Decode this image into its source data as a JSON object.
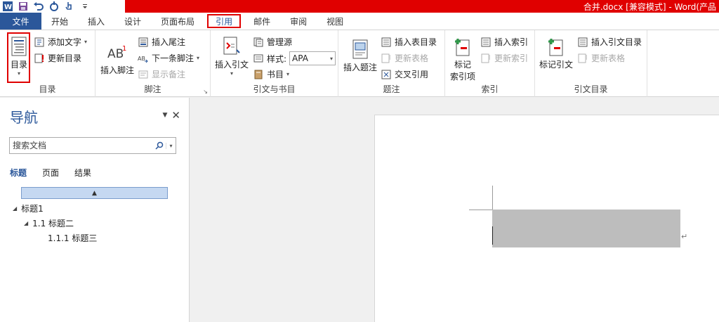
{
  "window": {
    "title": "合并.docx [兼容模式] - Word(产品"
  },
  "quick_access": [
    {
      "icon": "word-logo-icon"
    },
    {
      "icon": "save-icon"
    },
    {
      "icon": "undo-icon"
    },
    {
      "icon": "redo-icon"
    },
    {
      "icon": "touch-mode-icon"
    },
    {
      "icon": "customize-qat-icon"
    }
  ],
  "tabs": {
    "file": "文件",
    "home": "开始",
    "insert": "插入",
    "design": "设计",
    "layout": "页面布局",
    "references": "引用",
    "mailings": "邮件",
    "review": "审阅",
    "view": "视图"
  },
  "ribbon": {
    "toc_group": {
      "label": "目录",
      "toc_button": "目录",
      "add_text": "添加文字",
      "update_table": "更新目录"
    },
    "footnotes_group": {
      "label": "脚注",
      "insert_footnote": "插入脚注",
      "insert_endnote": "插入尾注",
      "next_footnote": "下一条脚注",
      "show_notes": "显示备注"
    },
    "citations_group": {
      "label": "引文与书目",
      "insert_citation": "插入引文",
      "manage_sources": "管理源",
      "style_label": "样式:",
      "style_value": "APA",
      "bibliography": "书目"
    },
    "captions_group": {
      "label": "题注",
      "insert_caption": "插入题注",
      "insert_table_of_figures": "插入表目录",
      "update_table": "更新表格",
      "cross_reference": "交叉引用"
    },
    "index_group": {
      "label": "索引",
      "mark_entry_line1": "标记",
      "mark_entry_line2": "索引项",
      "insert_index": "插入索引",
      "update_index": "更新索引"
    },
    "toa_group": {
      "label": "引文目录",
      "mark_citation": "标记引文",
      "insert_toa": "插入引文目录",
      "update_table": "更新表格"
    }
  },
  "nav_pane": {
    "title": "导航",
    "search_placeholder": "搜索文档",
    "tabs": [
      "标题",
      "页面",
      "结果"
    ],
    "headings": [
      {
        "level": 1,
        "text": "标题1"
      },
      {
        "level": 2,
        "text": "1.1 标题二"
      },
      {
        "level": 3,
        "text": "1.1.1 标题三"
      }
    ]
  },
  "document": {
    "paragraph_mark": "↵"
  },
  "colors": {
    "title_bar": "#e00000",
    "file_tab": "#2b579a",
    "highlight_box": "#e00000",
    "nav_title": "#2b579a"
  }
}
